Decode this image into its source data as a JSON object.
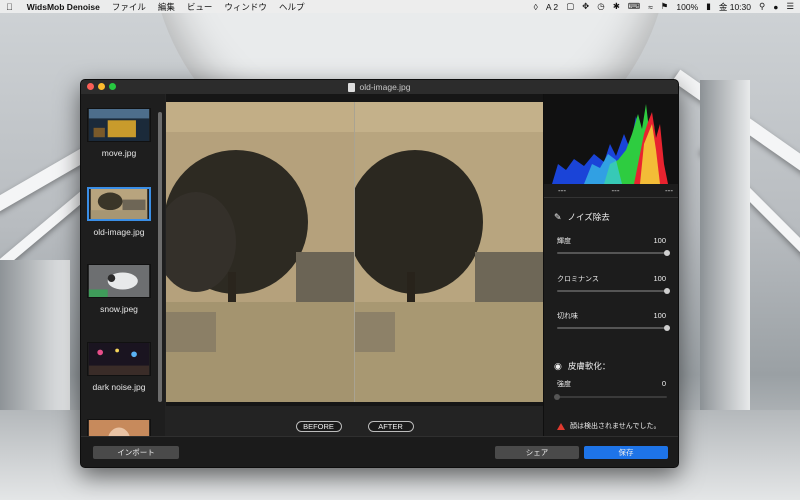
{
  "menubar": {
    "app_name": "WidsMob Denoise",
    "items": [
      "ファイル",
      "編集",
      "ビュー",
      "ウィンドウ",
      "ヘルプ"
    ],
    "status": {
      "adobe_count": "2",
      "battery": "100%",
      "clock": "金 10:30"
    }
  },
  "window": {
    "title": "old-image.jpg"
  },
  "sidebar": {
    "items": [
      {
        "label": "move.jpg"
      },
      {
        "label": "old-image.jpg"
      },
      {
        "label": "snow.jpeg"
      },
      {
        "label": "dark noise.jpg"
      }
    ]
  },
  "preview": {
    "before_label": "BEFORE",
    "after_label": "AFTER"
  },
  "histogram": {
    "values": [
      "---",
      "---",
      "---"
    ]
  },
  "noise": {
    "title": "ノイズ除去",
    "sliders": [
      {
        "label": "輝度",
        "value": "100",
        "level": 1.0
      },
      {
        "label": "クロミナンス",
        "value": "100",
        "level": 1.0
      },
      {
        "label": "切れ味",
        "value": "100",
        "level": 1.0
      }
    ]
  },
  "skin": {
    "title": "皮膚軟化：",
    "strength_label": "強度",
    "strength_value": "0",
    "level": 0,
    "warning": "顔は検出されませんでした。"
  },
  "bottom": {
    "import_label": "インポート",
    "share_label": "シェア",
    "save_label": "保存"
  },
  "colors": {
    "accent": "#1e74e8",
    "selection": "#3a8ee6",
    "warning": "#e03a2f"
  }
}
